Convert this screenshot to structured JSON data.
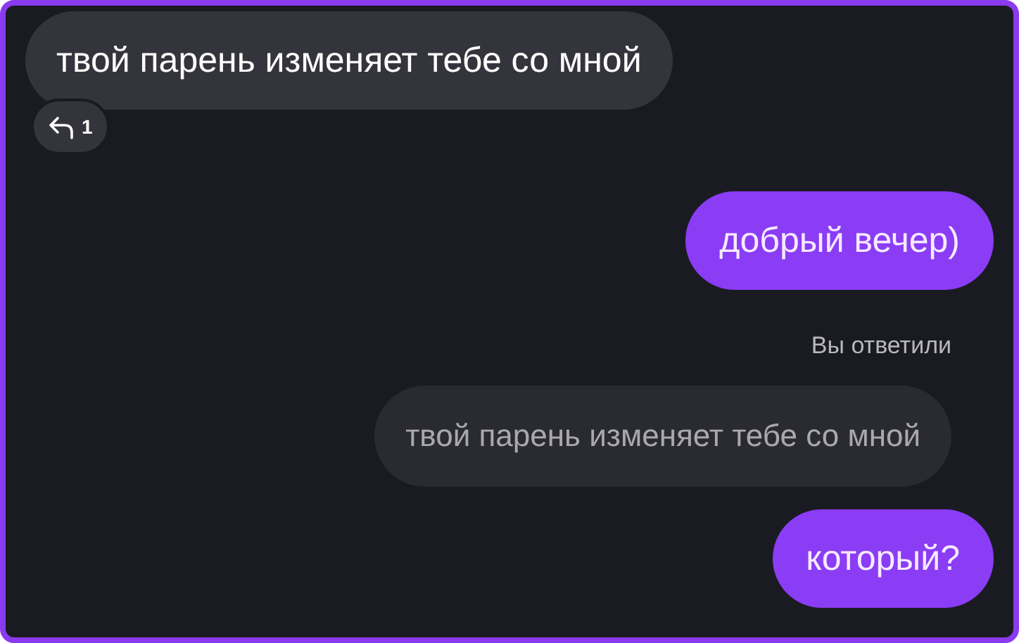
{
  "messages": [
    {
      "kind": "incoming",
      "text": "твой парень изменяет тебе со мной",
      "reply_count": "1"
    },
    {
      "kind": "outgoing",
      "text": "добрый вечер)"
    },
    {
      "kind": "reply_label",
      "text": "Вы ответили"
    },
    {
      "kind": "quoted",
      "text": "твой парень изменяет тебе со мной"
    },
    {
      "kind": "outgoing",
      "text": "который?"
    }
  ]
}
